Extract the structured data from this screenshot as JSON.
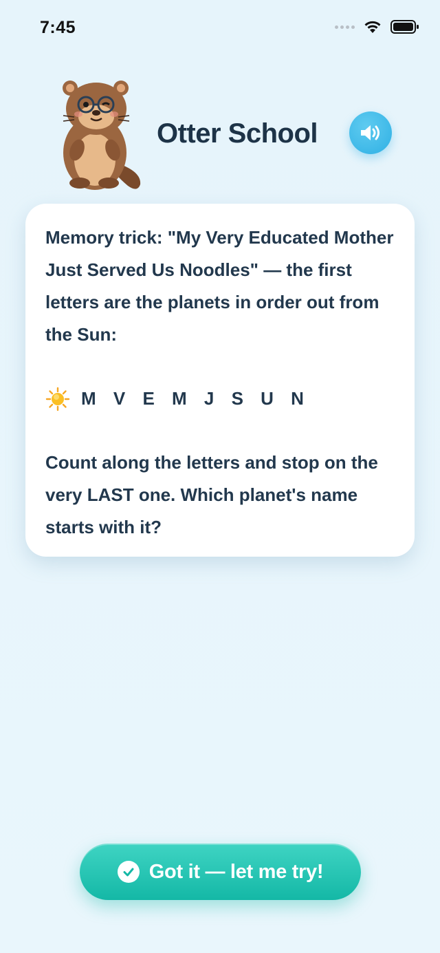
{
  "status_bar": {
    "time": "7:45",
    "icons": [
      "signal-dots-icon",
      "wifi-icon",
      "battery-icon"
    ]
  },
  "header": {
    "title": "Otter School",
    "mascot": "otter-mascot-icon",
    "sound_button_icon": "speaker-icon"
  },
  "card": {
    "paragraph1": "Memory trick: \"My Very Educated Mother Just Served Us Noodles\" — the first letters are the planets in order out from the Sun:",
    "sun_icon": "sun-icon",
    "letters": "M V E M J S U N",
    "paragraph2": "Count along the letters and stop on the very LAST one. Which planet's name starts with it?"
  },
  "cta": {
    "label": "Got it — let me try!",
    "icon": "check-circle-icon"
  },
  "colors": {
    "background": "#e8f5fb",
    "text": "#22384d",
    "accent_blue": "#2fb0e4",
    "accent_teal": "#14b8a6"
  }
}
